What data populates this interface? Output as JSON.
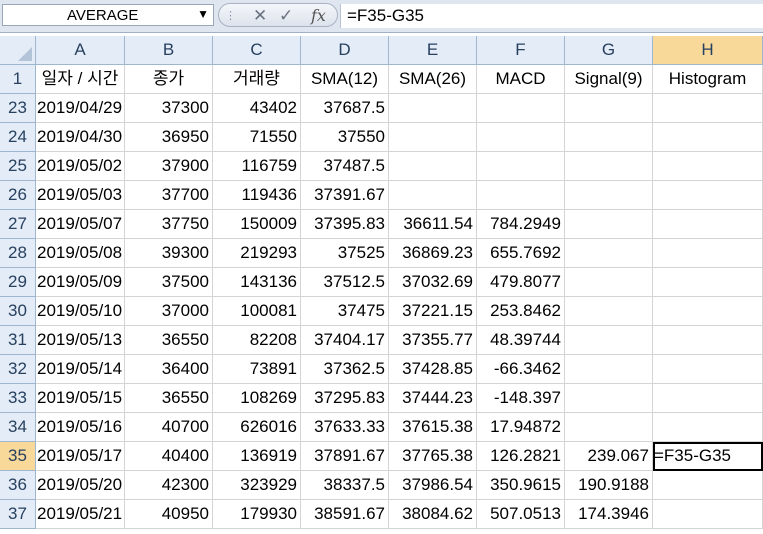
{
  "formula_bar": {
    "name_box": "AVERAGE",
    "formula": "=F35-G35"
  },
  "columns": [
    "A",
    "B",
    "C",
    "D",
    "E",
    "F",
    "G",
    "H"
  ],
  "header_row": {
    "row_num": "1",
    "cells": [
      "일자 / 시간",
      "종가",
      "거래량",
      "SMA(12)",
      "SMA(26)",
      "MACD",
      "Signal(9)",
      "Histogram"
    ]
  },
  "rows": [
    {
      "n": "23",
      "cells": [
        "2019/04/29",
        "37300",
        "43402",
        "37687.5",
        "",
        "",
        "",
        ""
      ]
    },
    {
      "n": "24",
      "cells": [
        "2019/04/30",
        "36950",
        "71550",
        "37550",
        "",
        "",
        "",
        ""
      ]
    },
    {
      "n": "25",
      "cells": [
        "2019/05/02",
        "37900",
        "116759",
        "37487.5",
        "",
        "",
        "",
        ""
      ]
    },
    {
      "n": "26",
      "cells": [
        "2019/05/03",
        "37700",
        "119436",
        "37391.67",
        "",
        "",
        "",
        ""
      ]
    },
    {
      "n": "27",
      "cells": [
        "2019/05/07",
        "37750",
        "150009",
        "37395.83",
        "36611.54",
        "784.2949",
        "",
        ""
      ]
    },
    {
      "n": "28",
      "cells": [
        "2019/05/08",
        "39300",
        "219293",
        "37525",
        "36869.23",
        "655.7692",
        "",
        ""
      ]
    },
    {
      "n": "29",
      "cells": [
        "2019/05/09",
        "37500",
        "143136",
        "37512.5",
        "37032.69",
        "479.8077",
        "",
        ""
      ]
    },
    {
      "n": "30",
      "cells": [
        "2019/05/10",
        "37000",
        "100081",
        "37475",
        "37221.15",
        "253.8462",
        "",
        ""
      ]
    },
    {
      "n": "31",
      "cells": [
        "2019/05/13",
        "36550",
        "82208",
        "37404.17",
        "37355.77",
        "48.39744",
        "",
        ""
      ]
    },
    {
      "n": "32",
      "cells": [
        "2019/05/14",
        "36400",
        "73891",
        "37362.5",
        "37428.85",
        "-66.3462",
        "",
        ""
      ]
    },
    {
      "n": "33",
      "cells": [
        "2019/05/15",
        "36550",
        "108269",
        "37295.83",
        "37444.23",
        "-148.397",
        "",
        ""
      ]
    },
    {
      "n": "34",
      "cells": [
        "2019/05/16",
        "40700",
        "626016",
        "37633.33",
        "37615.38",
        "17.94872",
        "",
        ""
      ]
    },
    {
      "n": "35",
      "cells": [
        "2019/05/17",
        "40400",
        "136919",
        "37891.67",
        "37765.38",
        "126.2821",
        "239.067",
        "=F35-G35"
      ]
    },
    {
      "n": "36",
      "cells": [
        "2019/05/20",
        "42300",
        "323929",
        "38337.5",
        "37986.54",
        "350.9615",
        "190.9188",
        ""
      ]
    },
    {
      "n": "37",
      "cells": [
        "2019/05/21",
        "40950",
        "179930",
        "38591.67",
        "38084.62",
        "507.0513",
        "174.3946",
        ""
      ]
    }
  ]
}
